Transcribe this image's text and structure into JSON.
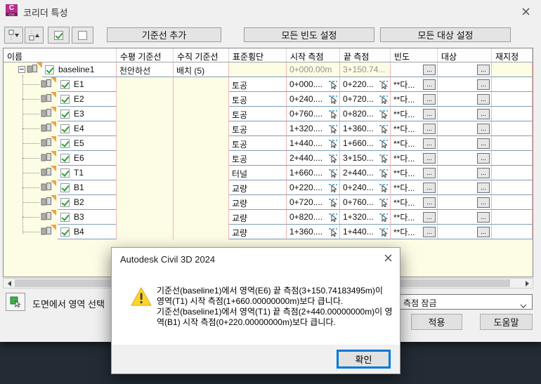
{
  "window": {
    "title": "코리더 특성"
  },
  "toolbar": {
    "add_baseline": "기준선 추가",
    "set_all_frequencies": "모든 빈도 설정",
    "set_all_targets": "모든 대상 설정"
  },
  "table": {
    "columns": [
      "이름",
      "수평 기준선",
      "수직 기준선",
      "표준횡단",
      "시작 측점",
      "끝 측점",
      "빈도",
      "대상",
      "재지정"
    ],
    "ellipsis": "...",
    "baseline": {
      "name": "baseline1",
      "checked": true,
      "horizontal_baseline": "천안하선",
      "vertical_baseline": "배치 (5)",
      "start_station": "0+000.00m",
      "end_station": "3+150.74..."
    },
    "regions": [
      {
        "name": "E1",
        "assembly": "토공",
        "start": "0+000....",
        "end": "0+220...",
        "frequency": "**다..."
      },
      {
        "name": "E2",
        "assembly": "토공",
        "start": "0+240....",
        "end": "0+720...",
        "frequency": "**다..."
      },
      {
        "name": "E3",
        "assembly": "토공",
        "start": "0+760....",
        "end": "0+820...",
        "frequency": "**다..."
      },
      {
        "name": "E4",
        "assembly": "토공",
        "start": "1+320....",
        "end": "1+360...",
        "frequency": "**다..."
      },
      {
        "name": "E5",
        "assembly": "토공",
        "start": "1+440....",
        "end": "1+660...",
        "frequency": "**다..."
      },
      {
        "name": "E6",
        "assembly": "토공",
        "start": "2+440....",
        "end": "3+150...",
        "frequency": "**다..."
      },
      {
        "name": "T1",
        "assembly": "터널",
        "start": "1+660....",
        "end": "2+440...",
        "frequency": "**다..."
      },
      {
        "name": "B1",
        "assembly": "교량",
        "start": "0+220....",
        "end": "0+240...",
        "frequency": "**다..."
      },
      {
        "name": "B2",
        "assembly": "교량",
        "start": "0+720....",
        "end": "0+760...",
        "frequency": "**다..."
      },
      {
        "name": "B3",
        "assembly": "교량",
        "start": "0+820....",
        "end": "1+320...",
        "frequency": "**다..."
      },
      {
        "name": "B4",
        "assembly": "교량",
        "start": "1+360....",
        "end": "1+440...",
        "frequency": "**다..."
      }
    ]
  },
  "footer": {
    "select_region_label": "도면에서 영역 선택",
    "lock_dropdown_value": "측점 잠금",
    "apply_label": "적용",
    "help_label": "도움말"
  },
  "modal": {
    "title": "Autodesk Civil 3D 2024",
    "messages": [
      "기준선(baseline1)에서 영역(E6) 끝 측점(3+150.74183495m)이 영역(T1) 시작 측점(1+660.00000000m)보다 큽니다.",
      "기준선(baseline1)에서 영역(T1) 끝 측점(2+440.00000000m)이 영역(B1) 시작 측점(0+220.00000000m)보다 큽니다."
    ],
    "ok_label": "확인"
  },
  "colors": {
    "brand_magenta": "#b5308a",
    "accent_blue": "#0078d7",
    "warning_yellow": "#ffd42a",
    "row_border": "#7d9db8",
    "column_border": "#f2b6b4",
    "grid_background": "#fdfce5",
    "app_background": "#232b34",
    "check_green": "#2e9e3a",
    "marker_orange": "#f2a33c"
  }
}
